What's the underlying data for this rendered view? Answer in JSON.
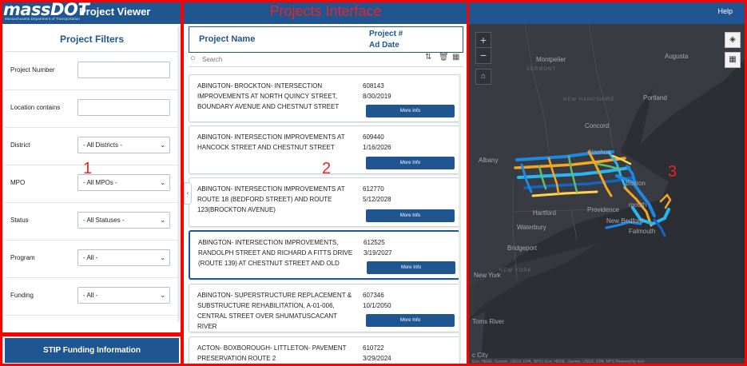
{
  "left_panel": {
    "brand": "massDOT",
    "brand_sub": "Massachusetts Department of Transportation",
    "app_title": "Project Viewer",
    "filters_title": "Project Filters",
    "filters": [
      {
        "label": "Project Number",
        "type": "input",
        "value": ""
      },
      {
        "label": "Location contains",
        "type": "input",
        "value": ""
      },
      {
        "label": "District",
        "type": "select",
        "value": "- All Districts -"
      },
      {
        "label": "MPO",
        "type": "select",
        "value": "- All MPOs -"
      },
      {
        "label": "Status",
        "type": "select",
        "value": "- All Statuses -"
      },
      {
        "label": "Program",
        "type": "select",
        "value": "- All -"
      },
      {
        "label": "Funding",
        "type": "select",
        "value": "- All -"
      }
    ],
    "stip_button": "STIP Funding Information",
    "annotation": "1"
  },
  "middle_panel": {
    "title": "Projects Interface",
    "header_name": "Project Name",
    "header_num_line1": "Project #",
    "header_num_line2": "Ad Date",
    "search_placeholder": "Search",
    "tool_icons": [
      "sort-icon",
      "trash-icon",
      "grid-icon"
    ],
    "tool_glyphs": [
      "⇅",
      "🗑",
      "▦"
    ],
    "more_label": "More Info",
    "projects": [
      {
        "name": "ABINGTON- BROCKTON- INTERSECTION IMPROVEMENTS AT NORTH QUINCY STREET, BOUNDARY AVENUE AND CHESTNUT STREET",
        "number": "608143",
        "date": "8/30/2019"
      },
      {
        "name": "ABINGTON- INTERSECTION IMPROVEMENTS AT HANCOCK STREET AND CHESTNUT STREET",
        "number": "609440",
        "date": "1/16/2026"
      },
      {
        "name": "ABINGTON- INTERSECTION IMPROVEMENTS AT ROUTE 18 (BEDFORD STREET) AND ROUTE 123(BROCKTON AVENUE)",
        "number": "612770",
        "date": "5/12/2028"
      },
      {
        "name": "ABINGTON- INTERSECTION IMPROVEMENTS, RANDOLPH STREET AND RICHARD A FITTS DRIVE (ROUTE 139) AT CHESTNUT STREET AND OLD",
        "number": "612525",
        "date": "3/19/2027"
      },
      {
        "name": "ABINGTON- SUPERSTRUCTURE REPLACEMENT & SUBSTRUCTURE REHABILITATION, A-01-006, CENTRAL STREET OVER SHUMATUSCACANT RIVER",
        "number": "607346",
        "date": "10/1/2050"
      },
      {
        "name": "ACTON- BOXBOROUGH- LITTLETON- PAVEMENT PRESERVATION ROUTE 2",
        "number": "610722",
        "date": "3/29/2024"
      }
    ],
    "annotation": "2"
  },
  "right_panel": {
    "help": "Help",
    "zoom_in": "+",
    "zoom_out": "−",
    "home_glyph": "⌂",
    "layers_glyph": "◈",
    "qr_glyph": "▦",
    "labels": {
      "montpelier": "Montpelier",
      "vermont": "VERMONT",
      "augusta": "Augusta",
      "new_hampshire": "NEW HAMPSHIRE",
      "portland": "Portland",
      "concord": "Concord",
      "nashua": "Nashua",
      "albany": "Albany",
      "boston": "Boston",
      "hartford": "Hartford",
      "providence": "Providence",
      "new_bedford": "New Bedford",
      "waterbury": "Waterbury",
      "bridgeport": "Bridgeport",
      "new_york": "New York",
      "new_york_state": "NEW YORK",
      "toms_river": "Toms River",
      "ac_city": "c City",
      "falmouth": "Falmouth",
      "plymouth": "mouth"
    },
    "attribution": "Esri, HERE, Garmin, USGS, EPA, NPS | Esri, HERE, Garmin, USGS, EPA, NPS          Powered by Esri",
    "annotation": "3"
  },
  "colors": {
    "brand_blue": "#1f5590",
    "annotation_red": "#ff0000",
    "map_background": "#2b2f34"
  }
}
